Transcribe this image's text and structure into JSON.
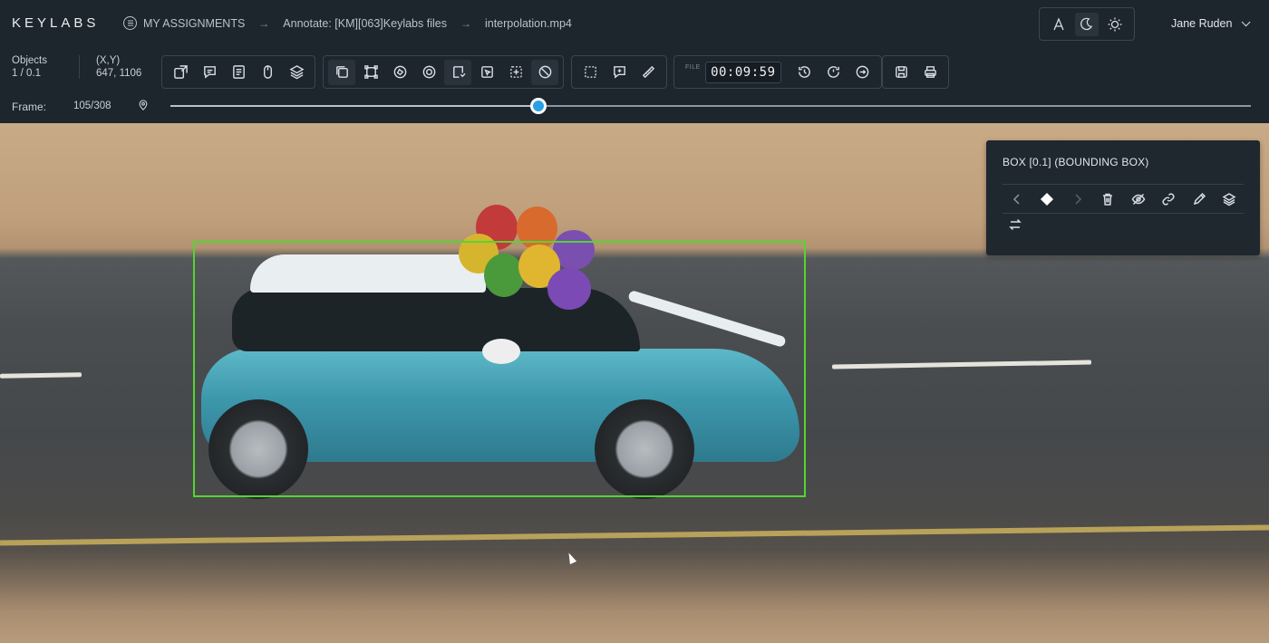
{
  "header": {
    "logo": "KEYLABS",
    "breadcrumb": [
      "MY ASSIGNMENTS",
      "Annotate: [KM][063]Keylabs files",
      "interpolation.mp4"
    ],
    "breadcrumb_arrow": "→",
    "user_name": "Jane Ruden",
    "theme_icons": [
      "font-icon",
      "moon-icon",
      "sun-icon"
    ]
  },
  "toolbar": {
    "objects_label": "Objects",
    "objects_value": "1 / 0.1",
    "coords_label": "(X,Y)",
    "coords_value": "647, 1106",
    "file_label": "FILE",
    "timer": "00:09:59"
  },
  "frame": {
    "label": "Frame:",
    "value": "105/308",
    "current": 105,
    "total": 308
  },
  "panel": {
    "title": "BOX [0.1] (BOUNDING BOX)"
  },
  "colors": {
    "bbox": "#53d62f",
    "accent": "#2aa0e0",
    "bar_bg": "#1d252d"
  }
}
